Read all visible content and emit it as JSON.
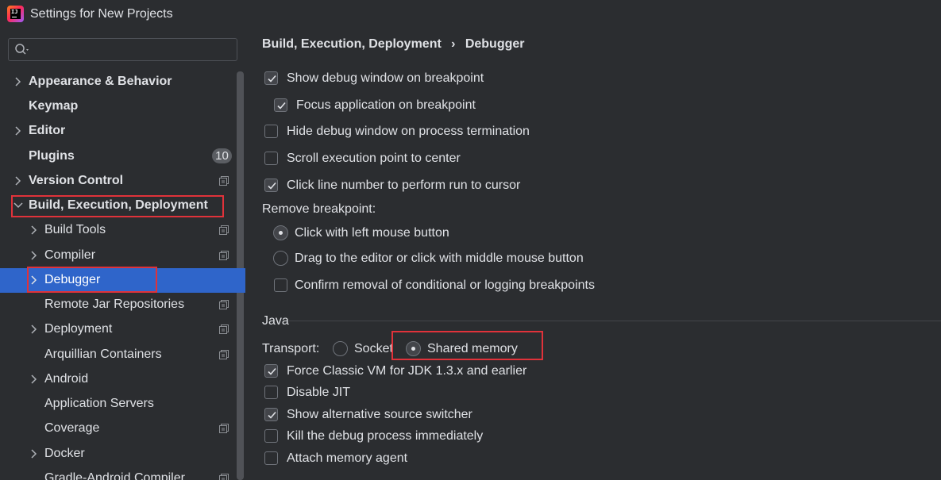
{
  "window": {
    "title": "Settings for New Projects"
  },
  "search": {
    "placeholder": "",
    "value": ""
  },
  "sidebar": {
    "items": [
      {
        "label": "Appearance & Behavior"
      },
      {
        "label": "Keymap"
      },
      {
        "label": "Editor"
      },
      {
        "label": "Plugins",
        "badge": "10"
      },
      {
        "label": "Version Control"
      },
      {
        "label": "Build, Execution, Deployment"
      },
      {
        "label": "Build Tools"
      },
      {
        "label": "Compiler"
      },
      {
        "label": "Debugger"
      },
      {
        "label": "Remote Jar Repositories"
      },
      {
        "label": "Deployment"
      },
      {
        "label": "Arquillian Containers"
      },
      {
        "label": "Android"
      },
      {
        "label": "Application Servers"
      },
      {
        "label": "Coverage"
      },
      {
        "label": "Docker"
      },
      {
        "label": "Gradle-Android Compiler"
      }
    ]
  },
  "breadcrumb": {
    "parent": "Build, Execution, Deployment",
    "separator": "›",
    "current": "Debugger"
  },
  "options": {
    "show_debug_window": {
      "label": "Show debug window on breakpoint",
      "checked": true
    },
    "focus_application": {
      "label": "Focus application on breakpoint",
      "checked": true
    },
    "hide_debug_window": {
      "label": "Hide debug window on process termination",
      "checked": false
    },
    "scroll_execution": {
      "label": "Scroll execution point to center",
      "checked": false
    },
    "click_line_number": {
      "label": "Click line number to perform run to cursor",
      "checked": true
    },
    "remove_breakpoint_label": "Remove breakpoint:",
    "click_left_mouse": {
      "label": "Click with left mouse button",
      "selected": true
    },
    "drag_to_editor": {
      "label": "Drag to the editor or click with middle mouse button",
      "selected": false
    },
    "confirm_removal": {
      "label": "Confirm removal of conditional or logging breakpoints",
      "checked": false
    }
  },
  "java": {
    "section_title": "Java",
    "transport_label": "Transport:",
    "socket": {
      "label": "Socket",
      "selected": false
    },
    "shared_memory": {
      "label": "Shared memory",
      "selected": true
    },
    "force_classic_vm": {
      "label": "Force Classic VM for JDK 1.3.x and earlier",
      "checked": true
    },
    "disable_jit": {
      "label": "Disable JIT",
      "checked": false
    },
    "show_alt_source": {
      "label": "Show alternative source switcher",
      "checked": true
    },
    "kill_debug_process": {
      "label": "Kill the debug process immediately",
      "checked": false
    },
    "attach_memory_agent": {
      "label": "Attach memory agent",
      "checked": false
    }
  },
  "colors": {
    "accent": "#2f65ca",
    "highlight_box": "#e0323a",
    "background": "#2b2d30",
    "text": "#dfe1e5"
  }
}
